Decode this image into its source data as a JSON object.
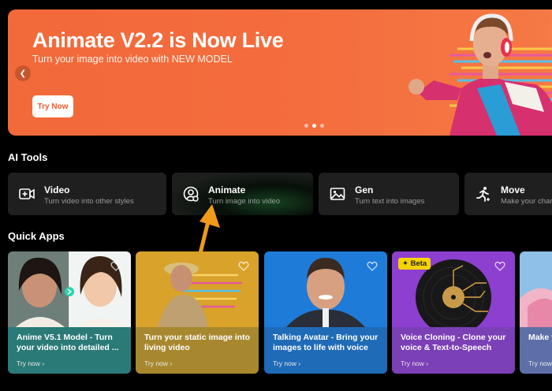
{
  "banner": {
    "title": "Animate V2.2 is Now Live",
    "subtitle": "Turn your image into video with NEW MODEL",
    "button": "Try Now",
    "prev_icon": "chevron-left-icon",
    "active_slide": 2,
    "slide_count": 3
  },
  "tools_section": {
    "title": "AI Tools"
  },
  "tools": [
    {
      "name": "Video",
      "desc": "Turn video into other styles",
      "icon": "video-plus-icon"
    },
    {
      "name": "Animate",
      "desc": "Turn image into video",
      "icon": "user-animate-icon"
    },
    {
      "name": "Gen",
      "desc": "Turn text into images",
      "icon": "image-icon"
    },
    {
      "name": "Move",
      "desc": "Make your chara",
      "icon": "run-icon"
    }
  ],
  "apps_section": {
    "title": "Quick Apps"
  },
  "apps": [
    {
      "title": "Anime V5.1 Model - Turn your video into detailed ...",
      "try": "Try now",
      "color": "#2a7a78"
    },
    {
      "title": "Turn your static image into living video",
      "try": "Try now",
      "color": "#a8882f"
    },
    {
      "title": "Talking Avatar - Bring your images to life with voice",
      "try": "Try now",
      "color": "#1f6bb8"
    },
    {
      "title": "Voice Cloning - Clone your voice & Text-to-Speech",
      "try": "Try now",
      "color": "#7b3fb6",
      "badge": "Beta"
    },
    {
      "title": "Make y with re",
      "try": "Try now",
      "color": "#5e6fa8"
    }
  ],
  "colors": {
    "accent": "#f2693a",
    "arrow": "#f29a1a"
  }
}
